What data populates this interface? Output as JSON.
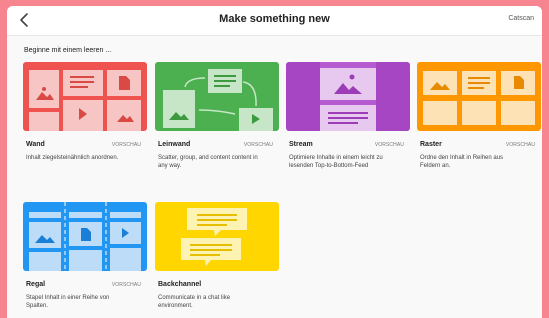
{
  "header": {
    "title": "Make something new",
    "account": "Catscan",
    "back_icon": "chevron-left-icon"
  },
  "section": {
    "title": "Beginne mit einem leeren ..."
  },
  "cards": [
    {
      "name": "Wand",
      "tag": "VORSCHAU",
      "desc": "Inhalt ziegelsteinähnlich anordnen.",
      "color": "#ef5350"
    },
    {
      "name": "Leinwand",
      "tag": "VORSCHAU",
      "desc": "Scatter, group, and content content in any way.",
      "color": "#4caf50"
    },
    {
      "name": "Stream",
      "tag": "VORSCHAU",
      "desc": "Optimiere Inhalte in einem leicht zu lesenden Top-to-Bottom-Feed",
      "color": "#a646c2"
    },
    {
      "name": "Raster",
      "tag": "VORSCHAU",
      "desc": "Ordne den Inhalt in Reihen aus Feldern an.",
      "color": "#ff9800"
    },
    {
      "name": "Regal",
      "tag": "VORSCHAU",
      "desc": "Stapel Inhalt in einer Reihe von Spalten.",
      "color": "#2196f3"
    },
    {
      "name": "Backchannel",
      "tag": "",
      "desc": "Communicate in a chat like environment.",
      "color": "#ffd600"
    }
  ]
}
